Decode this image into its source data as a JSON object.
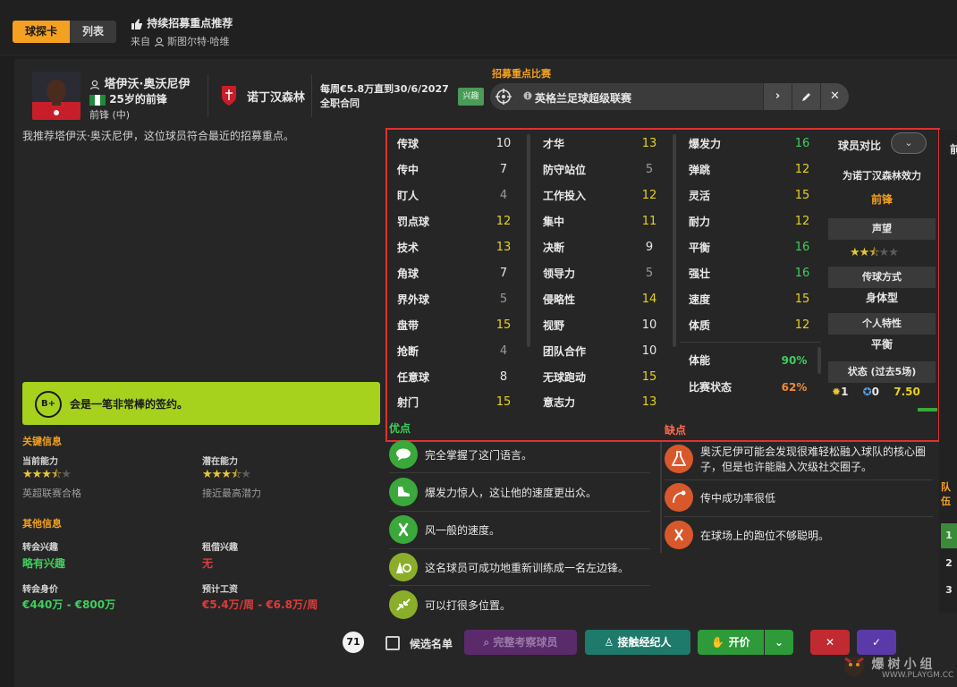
{
  "header": {
    "tabs": [
      {
        "label": "球探卡",
        "active": true
      },
      {
        "label": "列表",
        "active": false
      }
    ],
    "recommend_title": "持续招募重点推荐",
    "from_label": "来自",
    "from_name": "斯图尔特·哈维"
  },
  "player": {
    "name": "塔伊沃·奥沃尼伊",
    "age_role": "25岁的前锋",
    "position": "前锋 (中)",
    "club": "诺丁汉森林",
    "wage": "每周€5.8万直到30/6/2027",
    "contract": "全职合同",
    "recommend_text": "我推荐塔伊沃·奥沃尼伊，这位球员符合最近的招募重点。"
  },
  "recruit": {
    "label": "招募重点比赛",
    "interest": "兴趣",
    "league": "英格兰足球超级联赛"
  },
  "attributes": {
    "technical": [
      {
        "name": "传球",
        "value": "10",
        "tone": "w"
      },
      {
        "name": "传中",
        "value": "7",
        "tone": "w"
      },
      {
        "name": "盯人",
        "value": "4",
        "tone": "g"
      },
      {
        "name": "罚点球",
        "value": "12",
        "tone": "y"
      },
      {
        "name": "技术",
        "value": "13",
        "tone": "y"
      },
      {
        "name": "角球",
        "value": "7",
        "tone": "w"
      },
      {
        "name": "界外球",
        "value": "5",
        "tone": "g"
      },
      {
        "name": "盘带",
        "value": "15",
        "tone": "y"
      },
      {
        "name": "抢断",
        "value": "4",
        "tone": "g"
      },
      {
        "name": "任意球",
        "value": "8",
        "tone": "w"
      },
      {
        "name": "射门",
        "value": "15",
        "tone": "y"
      }
    ],
    "mental": [
      {
        "name": "才华",
        "value": "13",
        "tone": "y"
      },
      {
        "name": "防守站位",
        "value": "5",
        "tone": "g"
      },
      {
        "name": "工作投入",
        "value": "12",
        "tone": "y"
      },
      {
        "name": "集中",
        "value": "11",
        "tone": "y"
      },
      {
        "name": "决断",
        "value": "9",
        "tone": "w"
      },
      {
        "name": "领导力",
        "value": "5",
        "tone": "g"
      },
      {
        "name": "侵略性",
        "value": "14",
        "tone": "y"
      },
      {
        "name": "视野",
        "value": "10",
        "tone": "w"
      },
      {
        "name": "团队合作",
        "value": "10",
        "tone": "w"
      },
      {
        "name": "无球跑动",
        "value": "15",
        "tone": "y"
      },
      {
        "name": "意志力",
        "value": "13",
        "tone": "y"
      }
    ],
    "physical": [
      {
        "name": "爆发力",
        "value": "16",
        "tone": "gr"
      },
      {
        "name": "弹跳",
        "value": "12",
        "tone": "y"
      },
      {
        "name": "灵活",
        "value": "15",
        "tone": "y"
      },
      {
        "name": "耐力",
        "value": "12",
        "tone": "y"
      },
      {
        "name": "平衡",
        "value": "16",
        "tone": "gr"
      },
      {
        "name": "强壮",
        "value": "16",
        "tone": "gr"
      },
      {
        "name": "速度",
        "value": "15",
        "tone": "y"
      },
      {
        "name": "体质",
        "value": "12",
        "tone": "y"
      }
    ],
    "fitness_label": "体能",
    "fitness": "90%",
    "match_label": "比赛状态",
    "match": "62%"
  },
  "compare": {
    "title": "球员对比",
    "for_club": "为诺丁汉森林效力",
    "role": "前锋",
    "reputation_label": "声望",
    "reputation_stars": 2.5,
    "style_label": "传球方式",
    "style": "身体型",
    "trait_label": "个人特性",
    "trait": "平衡",
    "form_label": "状态 (过去5场)",
    "goals": "1",
    "assists": "0",
    "rating": "7.50"
  },
  "pros": {
    "label": "优点",
    "items": [
      {
        "icon": "speech-bubble-icon",
        "text": "完全掌握了这门语言。"
      },
      {
        "icon": "boot-icon",
        "text": "爆发力惊人，这让他的速度更出众。"
      },
      {
        "icon": "running-icon",
        "text": "风一般的速度。"
      },
      {
        "icon": "cone-ball-icon",
        "text": "这名球员可成功地重新训练成一名左边锋。"
      },
      {
        "icon": "arrows-icon",
        "text": "可以打很多位置。"
      }
    ]
  },
  "cons": {
    "label": "缺点",
    "items": [
      {
        "icon": "flask-icon",
        "text": "奥沃尼伊可能会发现很难轻松融入球队的核心圈子，但是也许能融入次级社交圈子。"
      },
      {
        "icon": "cross-ball-icon",
        "text": "传中成功率很低"
      },
      {
        "icon": "wrong-run-icon",
        "text": "在球场上的跑位不够聪明。"
      }
    ]
  },
  "summary": {
    "grade": "B+",
    "verdict": "会是一笔非常棒的签约。",
    "key_label": "关键信息",
    "current_label": "当前能力",
    "current_stars": 3.5,
    "current_sub": "英超联赛合格",
    "potential_label": "潜在能力",
    "potential_stars": 3.5,
    "potential_sub": "接近最高潜力",
    "other_label": "其他信息",
    "transfer_interest_label": "转会兴趣",
    "transfer_interest": "略有兴趣",
    "loan_interest_label": "租借兴趣",
    "loan_interest": "无",
    "value_label": "转会身价",
    "value": "€440万 - €800万",
    "wage_est_label": "预计工资",
    "wage_est": "€5.4万/周 - €6.8万/周"
  },
  "actions": {
    "count": "71",
    "shortlist": "候选名单",
    "full_scout": "完整考察球员",
    "contact_agent": "接触经纪人",
    "offer": "开价"
  },
  "side": {
    "cut_text": "前",
    "squad_label": "队伍",
    "rows": [
      "1",
      "2",
      "3"
    ]
  },
  "watermark": {
    "text": "爆树小组",
    "url": "WWW.PLAYGM.CC"
  },
  "colors": {
    "accent": "#f4a020",
    "good": "#3fce5c",
    "bad": "#e23a3a",
    "verdict": "#a6d21e",
    "highlight": "#e03030"
  }
}
